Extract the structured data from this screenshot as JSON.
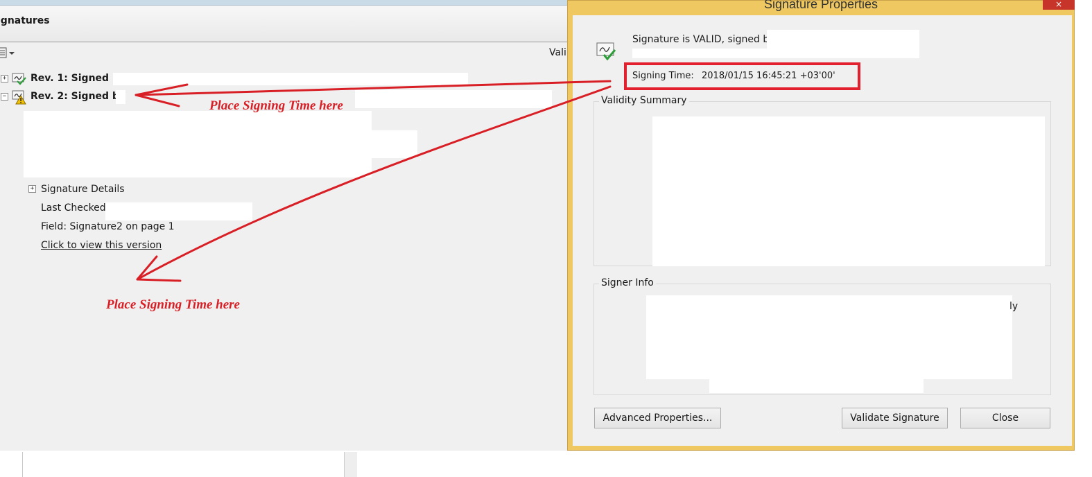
{
  "signatures_panel": {
    "title": "ignatures",
    "validity_column": "Vali",
    "revisions": [
      {
        "label": "Rev. 1: Signed by"
      },
      {
        "label": "Rev. 2: Signed by"
      }
    ],
    "details": {
      "signature_details": "Signature Details",
      "last_checked_label": "Last Checked:",
      "field": "Field: Signature2 on page 1",
      "view_version_link": "Click to view this version"
    }
  },
  "annotations": {
    "hint_1": "Place Signing Time here",
    "hint_2": "Place Signing Time here",
    "arrow_color": "#d91f26"
  },
  "dialog": {
    "title": "Signature Properties",
    "close_glyph": "×",
    "status_text": "Signature is VALID, signed by",
    "signing_time_label": "Signing Time:",
    "signing_time_value": "2018/01/15 16:45:21 +03'00'",
    "validity_summary_label": "Validity Summary",
    "signer_info_label": "Signer Info",
    "signer_info_fragment": "ly",
    "buttons": {
      "advanced": "Advanced Properties...",
      "validate": "Validate Signature",
      "close": "Close"
    }
  },
  "icons": {
    "revision_1": "signature-valid-icon",
    "revision_2": "signature-warning-icon",
    "status": "signature-valid-icon"
  },
  "colors": {
    "dialog_frame": "#f0c862",
    "highlight_box": "#e3202e"
  }
}
